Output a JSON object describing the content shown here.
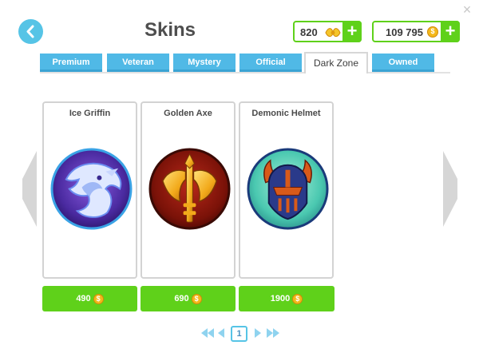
{
  "header": {
    "title": "Skins",
    "back_icon": "chevron-left-icon",
    "close_icon": "close-icon",
    "close_glyph": "×"
  },
  "currency": [
    {
      "id": "tokens",
      "amount": "820",
      "icon": "ticket-icon",
      "add_label": "+"
    },
    {
      "id": "coins",
      "amount": "109 795",
      "icon": "coin-icon",
      "add_label": "+"
    }
  ],
  "tabs": [
    {
      "label": "Premium",
      "active": false
    },
    {
      "label": "Veteran",
      "active": false
    },
    {
      "label": "Mystery",
      "active": false
    },
    {
      "label": "Official",
      "active": false
    },
    {
      "label": "Dark Zone",
      "active": true
    },
    {
      "label": "Owned",
      "active": false
    }
  ],
  "skins": [
    {
      "name": "Ice Griffin",
      "price": "490",
      "icon": "ice-griffin-icon"
    },
    {
      "name": "Golden Axe",
      "price": "690",
      "icon": "golden-axe-icon"
    },
    {
      "name": "Demonic Helmet",
      "price": "1900",
      "icon": "demonic-helmet-icon"
    }
  ],
  "pagination": {
    "current_page": "1"
  },
  "colors": {
    "accent_blue": "#50b9e6",
    "buy_green": "#5fd11a",
    "coin_gold": "#f4b81a"
  }
}
